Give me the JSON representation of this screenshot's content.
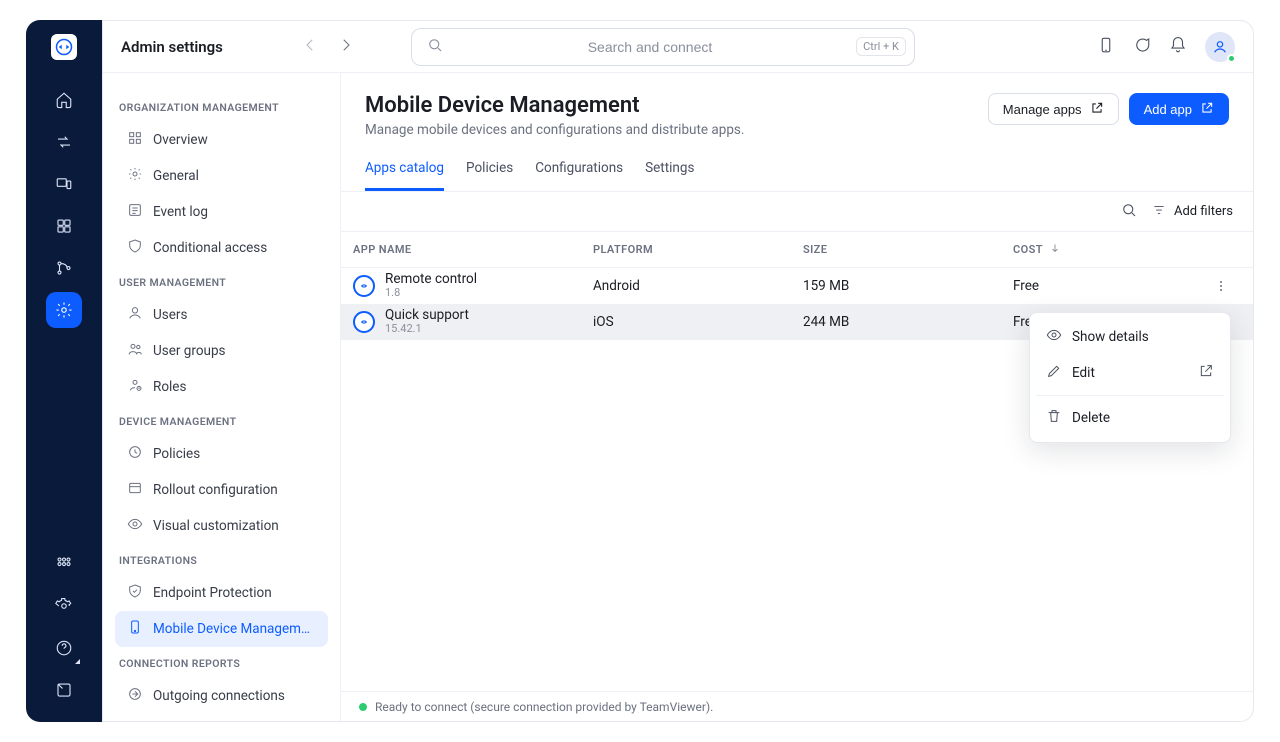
{
  "header": {
    "admin_title": "Admin settings",
    "search_placeholder": "Search and connect",
    "shortcut": "Ctrl + K"
  },
  "colors": {
    "accent": "#0d5cff",
    "rail_bg": "#0a1a3a",
    "status_green": "#2ecc71",
    "border": "#eef0f5"
  },
  "rail_items": [
    {
      "name": "home-icon"
    },
    {
      "name": "transfer-icon"
    },
    {
      "name": "devices-icon"
    },
    {
      "name": "stack-icon"
    },
    {
      "name": "branch-icon"
    },
    {
      "name": "gear-icon",
      "active": true
    }
  ],
  "rail_bottom": [
    {
      "name": "apps-icon"
    },
    {
      "name": "settings-icon"
    },
    {
      "name": "help-icon",
      "indicator": true
    },
    {
      "name": "panel-icon"
    }
  ],
  "topright": [
    {
      "name": "phone-icon"
    },
    {
      "name": "chat-icon"
    },
    {
      "name": "bell-icon"
    }
  ],
  "sidebar": {
    "groups": [
      {
        "title": "ORGANIZATION MANAGEMENT",
        "items": [
          {
            "icon": "grid-icon",
            "label": "Overview"
          },
          {
            "icon": "cog-icon",
            "label": "General"
          },
          {
            "icon": "log-icon",
            "label": "Event log"
          },
          {
            "icon": "shield-icon",
            "label": "Conditional access"
          }
        ]
      },
      {
        "title": "USER MANAGEMENT",
        "items": [
          {
            "icon": "user-icon",
            "label": "Users"
          },
          {
            "icon": "users-icon",
            "label": "User groups"
          },
          {
            "icon": "roles-icon",
            "label": "Roles"
          }
        ]
      },
      {
        "title": "DEVICE MANAGEMENT",
        "items": [
          {
            "icon": "policy-icon",
            "label": "Policies"
          },
          {
            "icon": "rollout-icon",
            "label": "Rollout configuration"
          },
          {
            "icon": "eye-icon",
            "label": "Visual customization"
          }
        ]
      },
      {
        "title": "INTEGRATIONS",
        "items": [
          {
            "icon": "guard-icon",
            "label": "Endpoint Protection"
          },
          {
            "icon": "mdm-icon",
            "label": "Mobile Device Managem…",
            "active": true
          }
        ]
      },
      {
        "title": "CONNECTION REPORTS",
        "items": [
          {
            "icon": "out-icon",
            "label": "Outgoing connections"
          }
        ]
      }
    ]
  },
  "page": {
    "title": "Mobile Device Management",
    "subtitle": "Manage mobile devices and configurations and distribute apps.",
    "manage_apps_label": "Manage apps",
    "add_app_label": "Add app"
  },
  "tabs": [
    {
      "label": "Apps catalog",
      "active": true
    },
    {
      "label": "Policies"
    },
    {
      "label": "Configurations"
    },
    {
      "label": "Settings"
    }
  ],
  "filterbar": {
    "add_filters_label": "Add filters"
  },
  "table": {
    "columns": {
      "app_name": "APP NAME",
      "platform": "PLATFORM",
      "size": "SIZE",
      "cost": "COST"
    },
    "rows": [
      {
        "name": "Remote control",
        "version": "1.8",
        "platform": "Android",
        "size": "159 MB",
        "cost": "Free"
      },
      {
        "name": "Quick support",
        "version": "15.42.1",
        "platform": "iOS",
        "size": "244 MB",
        "cost": "Free",
        "selected": true
      }
    ]
  },
  "context_menu": {
    "show_details": "Show details",
    "edit": "Edit",
    "delete": "Delete"
  },
  "status": {
    "text": "Ready to connect (secure connection provided by TeamViewer)."
  }
}
